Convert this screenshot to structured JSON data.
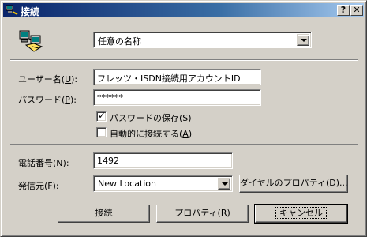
{
  "window": {
    "title": "接続"
  },
  "titlebar": {
    "help_label": "?",
    "close_label": "✕"
  },
  "entry": {
    "selected": "任意の名称",
    "icon": "network-computers-icon"
  },
  "username": {
    "label": "ユーザー名(",
    "key": "U",
    "suffix": "):",
    "value": "フレッツ・ISDN接続用アカウントID"
  },
  "password": {
    "label": "パスワード(",
    "key": "P",
    "suffix": "):",
    "value": "******"
  },
  "save_password": {
    "label": "パスワードの保存(",
    "key": "S",
    "suffix": ")",
    "checked": true,
    "mark": "✓"
  },
  "auto_connect": {
    "label": "自動的に接続する(",
    "key": "A",
    "suffix": ")",
    "checked": false,
    "mark": ""
  },
  "phone": {
    "label": "電話番号(",
    "key": "N",
    "suffix": "):",
    "value": "1492"
  },
  "dial_from": {
    "label": "発信元(",
    "key": "F",
    "suffix": "):",
    "value": "New Location"
  },
  "buttons": {
    "dial_properties": "ダイヤルのプロパティ(D)...",
    "connect": "接続",
    "properties": "プロパティ(R)",
    "cancel": "キャンセル"
  }
}
